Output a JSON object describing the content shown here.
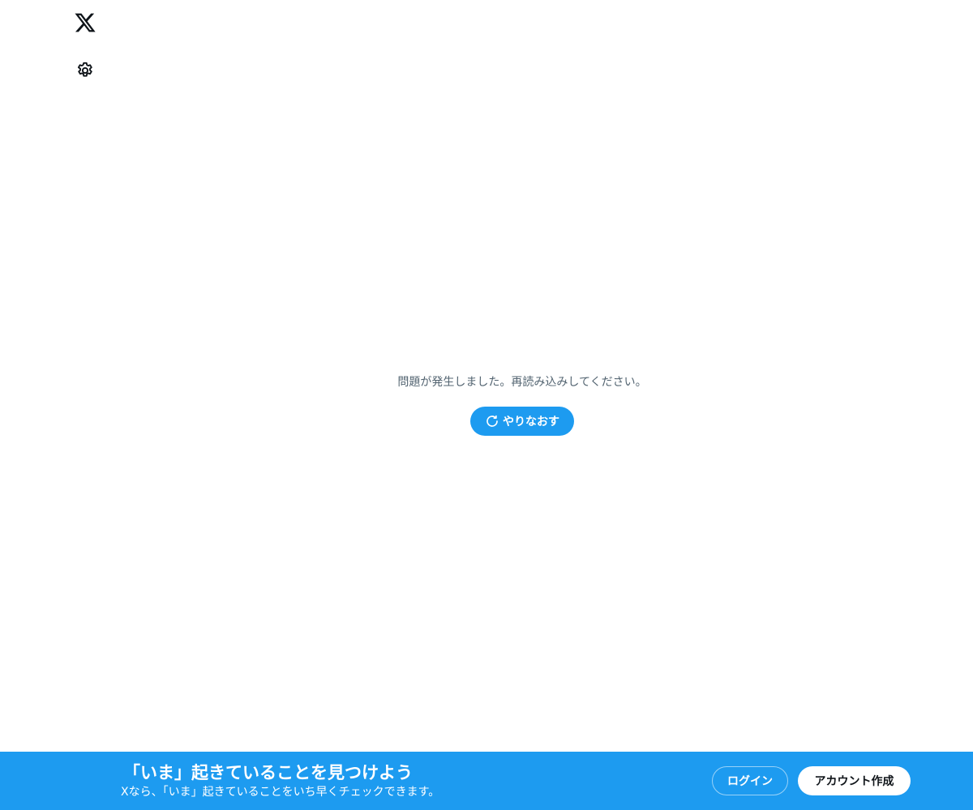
{
  "colors": {
    "accent": "#1d9bf0",
    "text_primary": "#0f1419",
    "text_secondary": "#536471",
    "background": "#ffffff"
  },
  "sidebar": {
    "logo_icon": "x-logo-icon",
    "settings_icon": "gear-icon"
  },
  "main": {
    "error_message": "問題が発生しました。再読み込みしてください。",
    "retry_icon": "refresh-icon",
    "retry_label": "やりなおす"
  },
  "bottom_bar": {
    "heading": "「いま」起きていることを見つけよう",
    "subtext": "Xなら、「いま」起きていることをいち早くチェックできます。",
    "login_label": "ログイン",
    "signup_label": "アカウント作成"
  }
}
